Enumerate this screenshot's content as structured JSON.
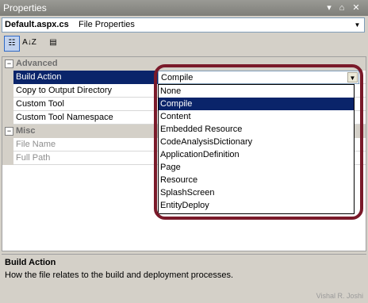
{
  "window": {
    "title": "Properties",
    "controls": [
      "▾",
      "⌂",
      "✕"
    ]
  },
  "object_selector": {
    "name": "Default.aspx.cs",
    "type": "File Properties"
  },
  "toolbar": {
    "categorized_icon": "☷",
    "alphabetical_icon": "A↓Z",
    "pages_icon": "▤"
  },
  "categories": [
    {
      "label": "Advanced",
      "toggle": "−"
    },
    {
      "label": "Misc",
      "toggle": "−"
    }
  ],
  "properties": [
    {
      "label": "Build Action"
    },
    {
      "label": "Copy to Output Directory"
    },
    {
      "label": "Custom Tool"
    },
    {
      "label": "Custom Tool Namespace"
    },
    {
      "label": "File Name"
    },
    {
      "label": "Full Path"
    }
  ],
  "combo": {
    "value": "Compile"
  },
  "dropdown_options": [
    "None",
    "Compile",
    "Content",
    "Embedded Resource",
    "CodeAnalysisDictionary",
    "ApplicationDefinition",
    "Page",
    "Resource",
    "SplashScreen",
    "EntityDeploy"
  ],
  "description": {
    "title": "Build Action",
    "text": "How the file relates to the build and deployment processes."
  },
  "watermark": "Vishal R. Joshi",
  "colors": {
    "highlight_circle": "#7a1a2a",
    "selection": "#0a246a"
  }
}
